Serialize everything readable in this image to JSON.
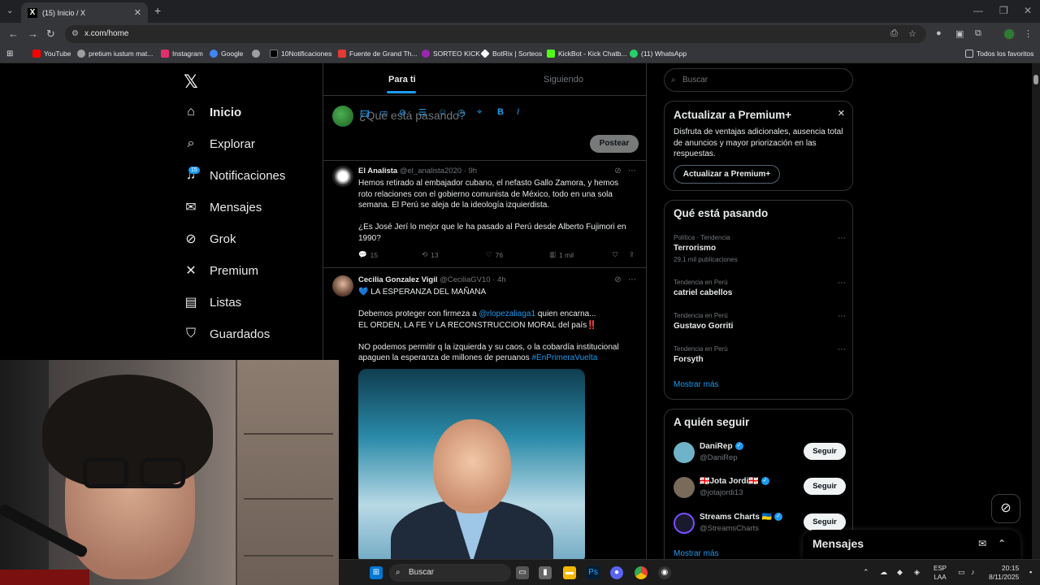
{
  "browser": {
    "tab_title": "(15) Inicio / X",
    "url": "x.com/home",
    "bookmarks": [
      {
        "label": "YouTube",
        "color": "#ff0000"
      },
      {
        "label": "pretium iustum mat...",
        "color": "#9e9e9e"
      },
      {
        "label": "Instagram",
        "color": "#e1306c"
      },
      {
        "label": "Google",
        "color": "#4285f4"
      },
      {
        "label": "",
        "color": "#9e9e9e"
      },
      {
        "label": "10Notificaciones",
        "color": "#000000"
      },
      {
        "label": "Fuente de Grand Th...",
        "color": "#e53935"
      },
      {
        "label": "SORTEO KICK",
        "color": "#9c27b0"
      },
      {
        "label": "BotRix | Sorteos",
        "color": "#ffffff"
      },
      {
        "label": "KickBot - Kick Chatb...",
        "color": "#53fc18"
      },
      {
        "label": "(11) WhatsApp",
        "color": "#25d366"
      }
    ],
    "all_bookmarks": "Todos los favoritos"
  },
  "nav": {
    "items": [
      {
        "label": "Inicio",
        "icon": "⌂",
        "active": true
      },
      {
        "label": "Explorar",
        "icon": "⌕"
      },
      {
        "label": "Notificaciones",
        "icon": "🔔"
      },
      {
        "label": "Mensajes",
        "icon": "✉"
      },
      {
        "label": "Grok",
        "icon": "⊘"
      },
      {
        "label": "Premium",
        "icon": "𝕏"
      },
      {
        "label": "Listas",
        "icon": "▤"
      },
      {
        "label": "Guardados",
        "icon": "⛉"
      }
    ],
    "notif_badge": "15"
  },
  "timeline": {
    "tab_for_you": "Para ti",
    "tab_following": "Siguiendo",
    "compose_placeholder": "¿Qué está pasando?",
    "post_button": "Postear",
    "tweets": [
      {
        "name": "El Analista",
        "handle": "@el_analista2020 · 9h",
        "p1": "Hemos retirado al embajador cubano, el nefasto Gallo Zamora, y hemos roto relaciones con el gobierno comunista de México, todo en una sola semana. El Perú se aleja de la ideología izquierdista.",
        "p2": "¿Es José Jerí lo mejor que le ha pasado al Perú desde Alberto Fujimori en 1990?",
        "replies": "15",
        "reposts": "13",
        "likes": "76",
        "views": "1 mil"
      },
      {
        "name": "Cecilia Gonzalez Vigil",
        "handle": "@CeciliaGV10 · 4h",
        "line1": "💙 LA ESPERANZA DEL MAÑANA",
        "line2_pre": "Debemos proteger con firmeza a ",
        "line2_link": "@rlopezaliaga1",
        "line2_post": " quien encarna...",
        "line3": "EL ORDEN, LA FE Y LA RECONSTRUCCION MORAL del país",
        "line3_mark": "‼️",
        "line4": "NO podemos permitir q la izquierda y su caos, o la cobardía institucional apaguen la esperanza de millones de peruanos ",
        "line4_tag": "#EnPrimeraVuelta"
      }
    ]
  },
  "sidebar": {
    "search_placeholder": "Buscar",
    "premium": {
      "title": "Actualizar a Premium+",
      "text": "Disfruta de ventajas adicionales, ausencia total de anuncios y mayor priorización en las respuestas.",
      "button": "Actualizar a Premium+"
    },
    "trends_title": "Qué está pasando",
    "trends": [
      {
        "category": "Política · Tendencia",
        "title": "Terrorismo",
        "count": "29,1 mil publicaciones"
      },
      {
        "category": "Tendencia en Perú",
        "title": "catriel cabellos",
        "count": ""
      },
      {
        "category": "Tendencia en Perú",
        "title": "Gustavo Gorriti",
        "count": ""
      },
      {
        "category": "Tendencia en Perú",
        "title": "Forsyth",
        "count": ""
      }
    ],
    "show_more": "Mostrar más",
    "follow_title": "A quién seguir",
    "follow": [
      {
        "name": "DaniRep",
        "handle": "@DaniRep",
        "button": "Seguir",
        "color": "#6fb3c8"
      },
      {
        "name": "🇬🇪Jota Jordi🇬🇪",
        "handle": "@jotajordi13",
        "button": "Seguir",
        "color": "#7a6a5a"
      },
      {
        "name": "Streams Charts 🇺🇦",
        "handle": "@StreamsCharts",
        "button": "Seguir",
        "color": "#1a1a2e"
      }
    ],
    "show_more_follow": "Mostrar más",
    "messages_drawer": "Mensajes"
  },
  "taskbar": {
    "search": "Buscar",
    "lang_line1": "ESP",
    "lang_line2": "LAA",
    "time": "20:15",
    "date": "8/11/2025"
  }
}
